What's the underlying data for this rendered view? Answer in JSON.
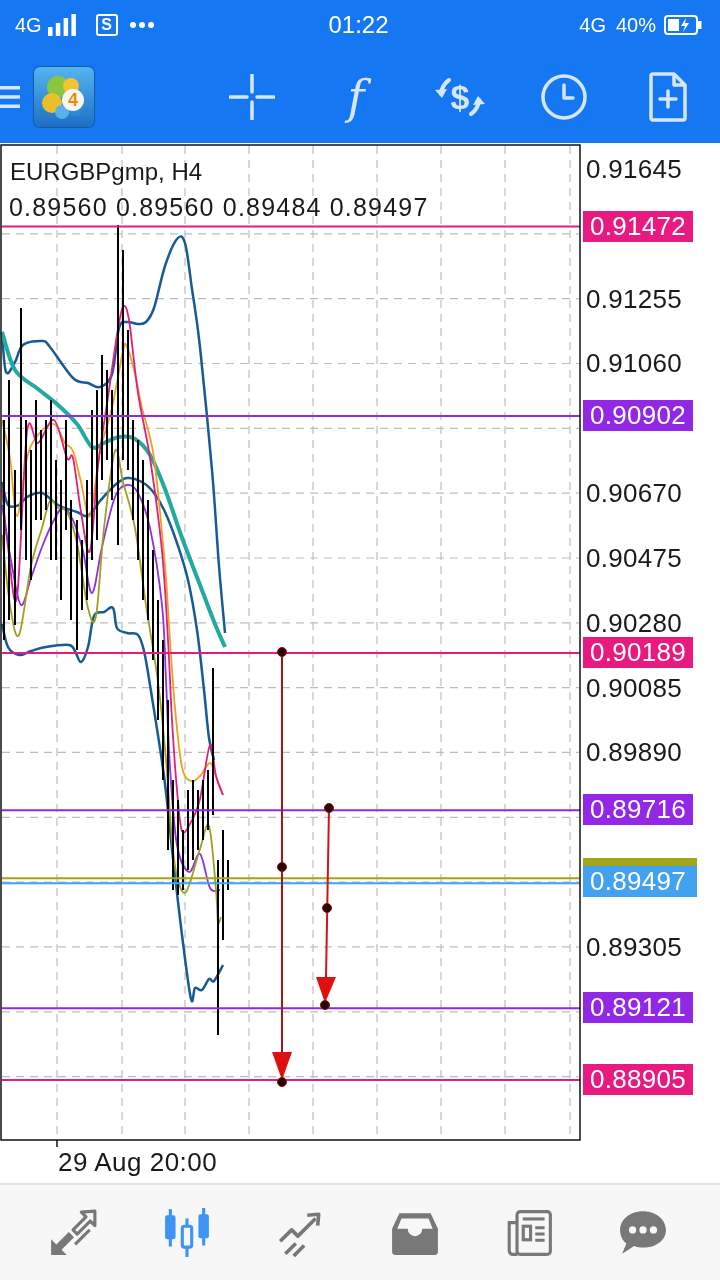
{
  "status_bar": {
    "network": "4G",
    "notification_badge": "S",
    "time": "01:22",
    "network_right": "4G",
    "battery": "40%"
  },
  "toolbar": {
    "logo_badge": "4",
    "function_glyph": "f",
    "currency_glyph": "$"
  },
  "chart": {
    "symbol": "EURGBPgmp, H4",
    "ohlc": "0.89560 0.89560 0.89484 0.89497",
    "price_ticks": [
      "0.91645",
      "0.91255",
      "0.91060",
      "0.90670",
      "0.90475",
      "0.90280",
      "0.90085",
      "0.89890",
      "0.89305"
    ],
    "time_label": "29 Aug 20:00",
    "levels": [
      {
        "kind": "level",
        "label": "0.91472",
        "color": "#e8197f"
      },
      {
        "kind": "level",
        "label": "0.90902",
        "color": "#9227e6"
      },
      {
        "kind": "level",
        "label": "0.90189",
        "color": "#e8197f"
      },
      {
        "kind": "level",
        "label": "0.89716",
        "color": "#9227e6"
      },
      {
        "kind": "current",
        "label": "0.89497",
        "color": "#42a1f0"
      },
      {
        "kind": "level",
        "label": "0.89121",
        "color": "#9227e6"
      },
      {
        "kind": "level",
        "label": "0.88905",
        "color": "#e8197f"
      }
    ]
  },
  "bottom_nav": [
    {
      "kind": "quotes",
      "selected": false
    },
    {
      "kind": "chart",
      "selected": true
    },
    {
      "kind": "trade",
      "selected": false
    },
    {
      "kind": "history",
      "selected": false
    },
    {
      "kind": "news",
      "selected": false
    },
    {
      "kind": "messages",
      "selected": false
    }
  ]
}
